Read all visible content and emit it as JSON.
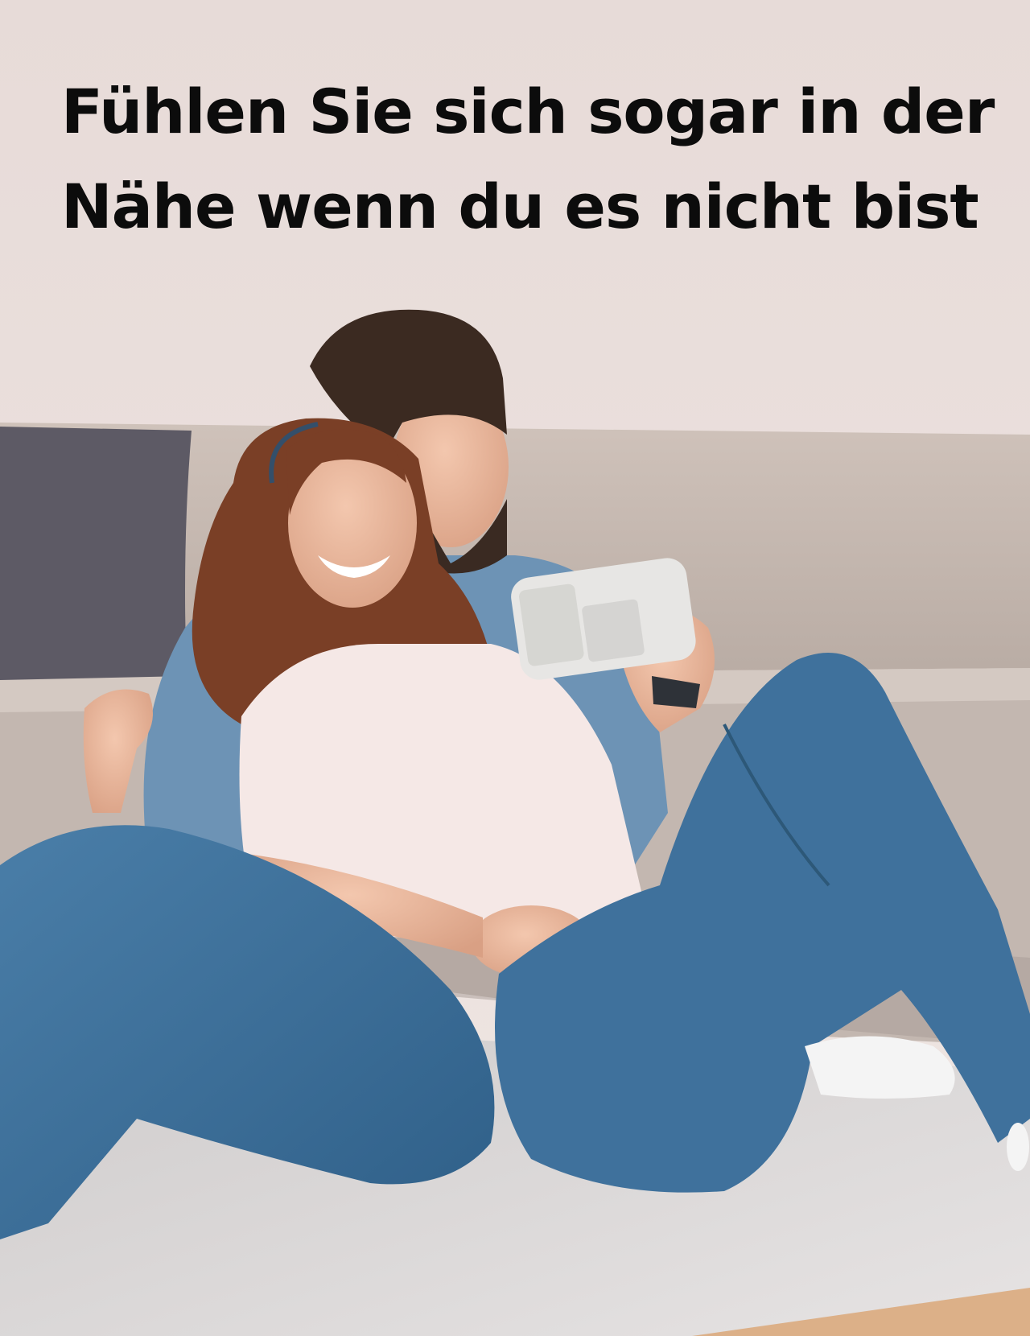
{
  "headline": {
    "line1": "Fühlen Sie sich sogar in der",
    "line2": "Nähe wenn du es nicht bist"
  },
  "colors": {
    "wall": "#eadfdc",
    "sofa": "#c9bdb5",
    "pillow": "#5d5a65",
    "denim": "#3d6f9a",
    "rug": "#d9d6d6",
    "floor": "#dcb088",
    "headline_text": "#0c0c0c"
  },
  "image": {
    "subject": "couple-on-floor-with-baby-monitor-photo",
    "device": "baby-monitor-device"
  }
}
